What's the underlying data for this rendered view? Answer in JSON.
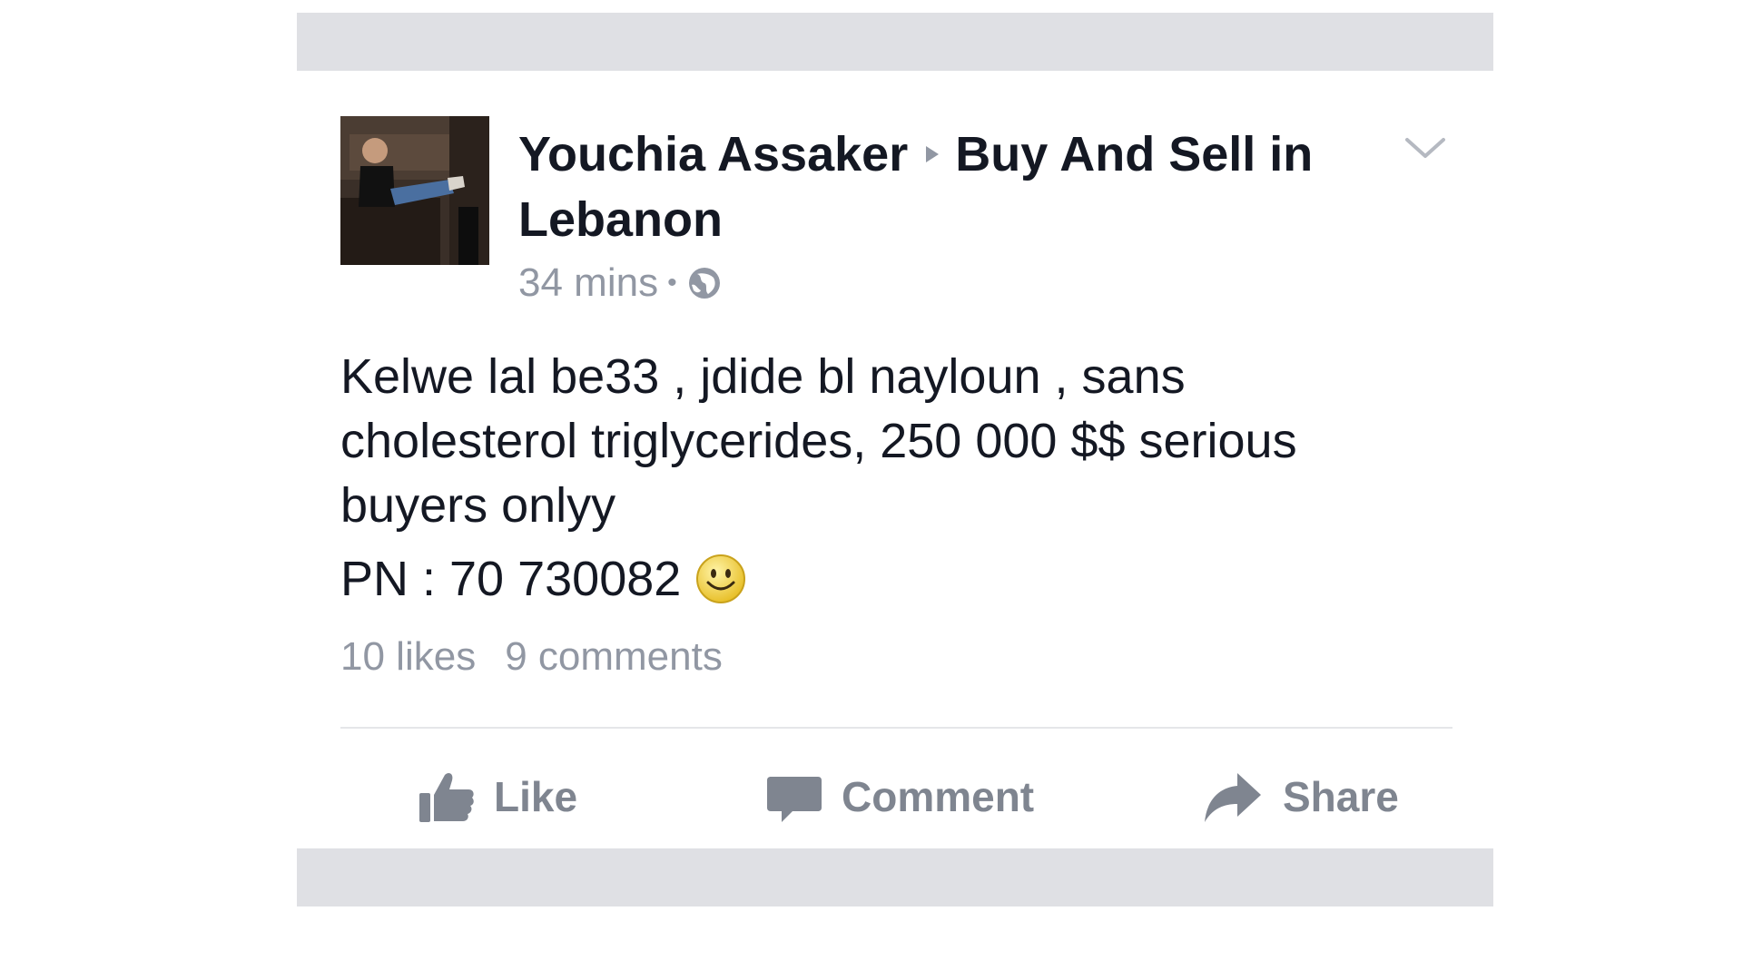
{
  "post": {
    "author": "Youchia Assaker",
    "group": "Buy And Sell in Lebanon",
    "timestamp": "34 mins",
    "separator": "•",
    "privacy_icon": "globe-icon",
    "body": "Kelwe lal be33 , jdide bl nayloun , sans cholesterol triglycerides, 250 000 $$ serious buyers onlyy",
    "phone_line": "PN : 70 730082",
    "emoji_icon": "smiley-icon",
    "menu_icon": "chevron-down-icon"
  },
  "stats": {
    "likes": "10 likes",
    "comments": "9 comments"
  },
  "actions": {
    "like_label": "Like",
    "comment_label": "Comment",
    "share_label": "Share"
  },
  "colors": {
    "text": "#141823",
    "muted": "#9197a3",
    "action": "#7f8590",
    "separator_bar": "#dfe0e4"
  }
}
